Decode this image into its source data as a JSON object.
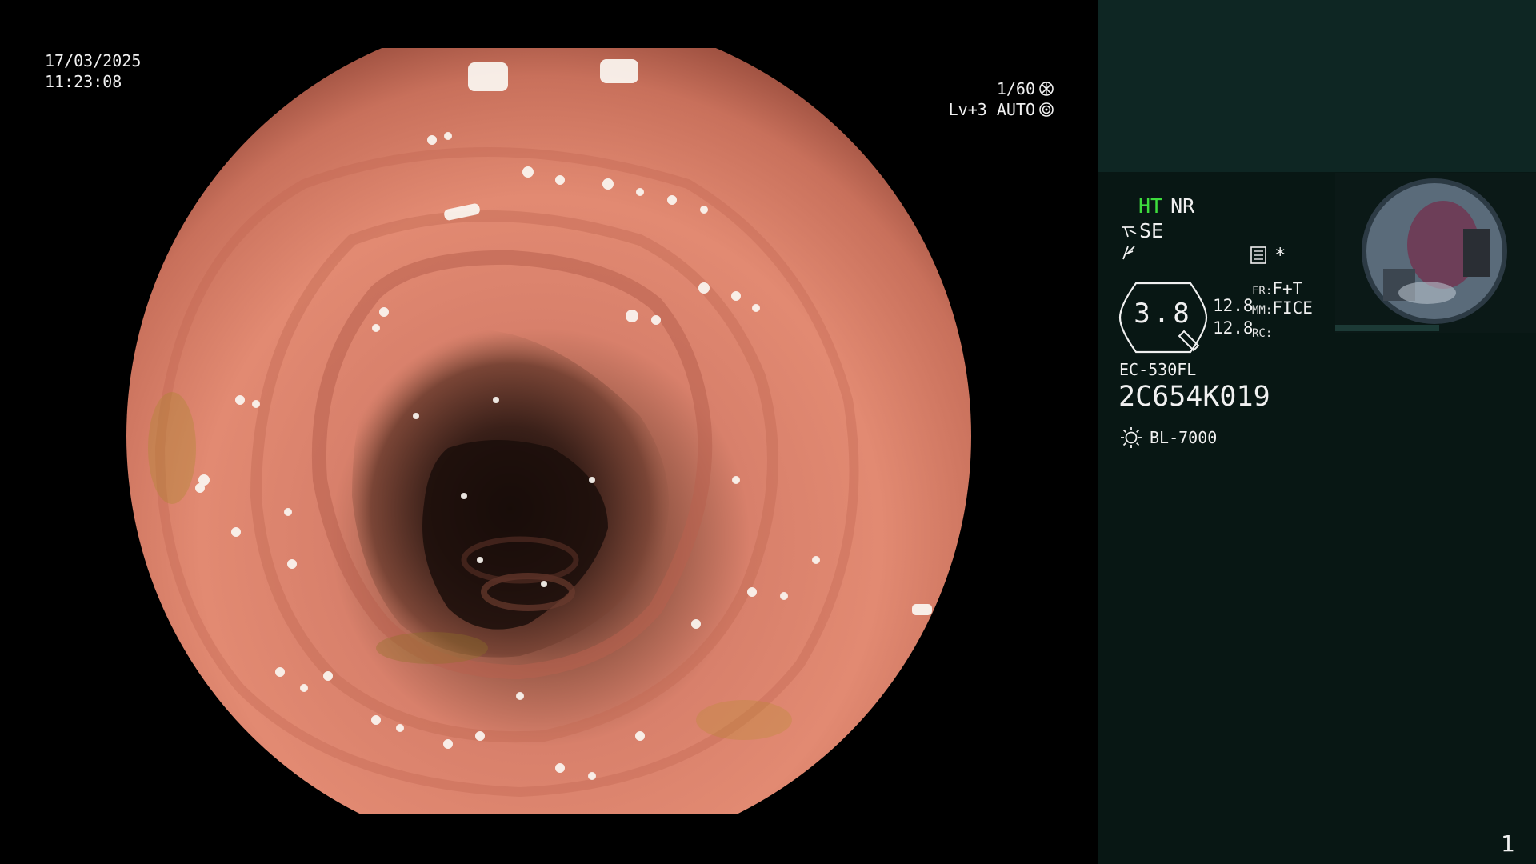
{
  "osd": {
    "date": "17/03/2025",
    "time": "11:23:08",
    "shutter": "1/60",
    "shutter_icon": "aperture-icon",
    "iris": "Lv+3 AUTO",
    "iris_icon": "iris-target-icon"
  },
  "panel": {
    "mode_ht": "HT",
    "mode_nr": "NR",
    "mode_ht_color": "#3ddc3d",
    "se_label": "SE",
    "se_icon": "structure-enhance-icon",
    "flash_icon": "lightning-icon",
    "menu_icon": "menu-box-icon",
    "asterisk": "*",
    "zoom_value": "3.8",
    "val_a": "12.8",
    "val_b": "12.8",
    "fr_key": "FR:",
    "fr_value": "F+T",
    "mm_key": "MM:",
    "mm_value": "FICE",
    "rc_key": "RC:",
    "rc_value": "",
    "scope_model": "EC-530FL",
    "scope_serial": "2C654K019",
    "light_icon": "sun-icon",
    "light_source": "BL-7000",
    "page_number": "1"
  },
  "colors": {
    "panel_bg": "#081714",
    "panel_top_bg": "#0e2623",
    "highlight_green": "#3ddc3d",
    "mucosa": "#d8806b"
  }
}
